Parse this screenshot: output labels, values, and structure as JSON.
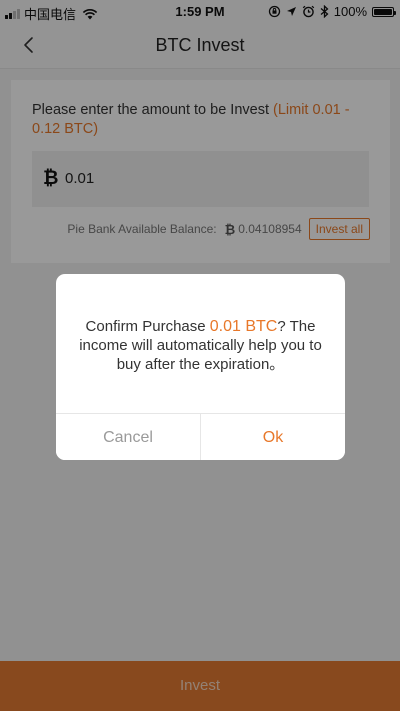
{
  "status_bar": {
    "carrier": "中国电信",
    "time": "1:59 PM",
    "battery": "100%"
  },
  "nav": {
    "title": "BTC Invest"
  },
  "form": {
    "prompt": "Please enter the amount to be Invest ",
    "limit": "(Limit 0.01 - 0.12 BTC)",
    "btc_symbol": "₿",
    "amount_value": "0.01",
    "balance_label": "Pie Bank Available Balance:",
    "balance_symbol": "₿",
    "balance_value": "0.04108954",
    "invest_all_label": "Invest all"
  },
  "dialog": {
    "message_prefix": "Confirm Purchase ",
    "amount": "0.01 BTC",
    "message_suffix": "? The income will automatically help you to buy after the expiration。",
    "cancel_label": "Cancel",
    "ok_label": "Ok"
  },
  "footer": {
    "invest_label": "Invest"
  },
  "colors": {
    "accent": "#e8782a",
    "invest_button_bg": "#e37a33"
  }
}
